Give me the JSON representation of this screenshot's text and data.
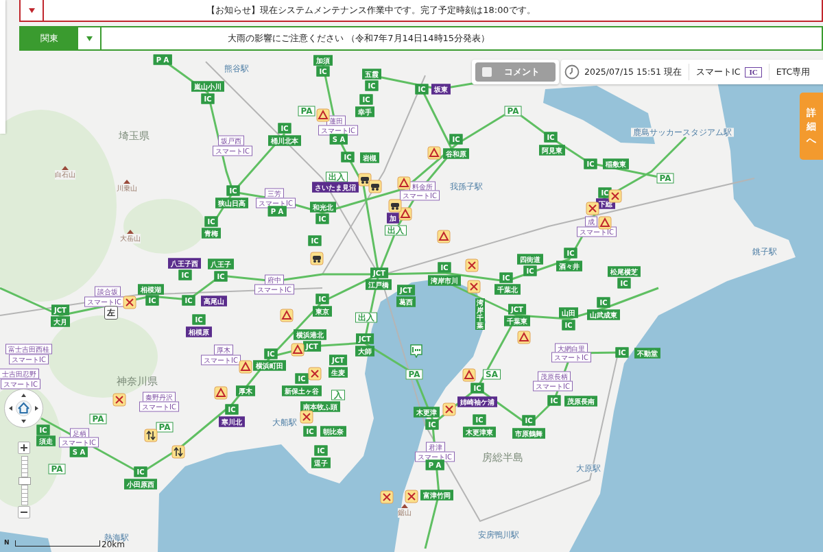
{
  "notices": [
    {
      "kind": "maintenance",
      "text": "【お知らせ】現在システムメンテナンス作業中です。完了予定時刻は18:00です。"
    },
    {
      "kind": "weather",
      "region": "関東",
      "text": "大雨の影響にご注意ください （令和7年7月14日14時15分発表）"
    }
  ],
  "comment_toggle": {
    "label": "コメント",
    "checked": false
  },
  "timestamp": "2025/07/15 15:51 現在",
  "legend": [
    {
      "label": "スマートIC",
      "badge": "IC"
    },
    {
      "label": "ETC専用"
    }
  ],
  "detail_tab": "詳細へ",
  "map": {
    "labels": [
      {
        "text": "P A",
        "kind": "g"
      },
      {
        "text": "加須",
        "kind": "g"
      },
      {
        "text": "IC",
        "kind": "g"
      },
      {
        "text": "五霞",
        "kind": "g"
      },
      {
        "text": "嵐山小川",
        "kind": "g"
      },
      {
        "text": "IC",
        "kind": "g"
      },
      {
        "text": "IC",
        "kind": "g"
      },
      {
        "text": "IC",
        "kind": "g"
      },
      {
        "text": "幸手",
        "kind": "g"
      },
      {
        "text": "IC",
        "kind": "g"
      },
      {
        "text": "坂東",
        "kind": "pf"
      },
      {
        "text": "PA",
        "kind": "go"
      },
      {
        "text": "蓮田",
        "kind": "p"
      },
      {
        "text": "スマートIC",
        "kind": "p"
      },
      {
        "text": "坂戸西",
        "kind": "p"
      },
      {
        "text": "スマートIC",
        "kind": "p"
      },
      {
        "text": "IC",
        "kind": "g"
      },
      {
        "text": "桶川北本",
        "kind": "g"
      },
      {
        "text": "S A",
        "kind": "g"
      },
      {
        "text": "IC",
        "kind": "g"
      },
      {
        "text": "岩槻",
        "kind": "g"
      },
      {
        "text": "PA",
        "kind": "go"
      },
      {
        "text": "IC",
        "kind": "g"
      },
      {
        "text": "谷和原",
        "kind": "g"
      },
      {
        "text": "IC",
        "kind": "g"
      },
      {
        "text": "阿見東",
        "kind": "g"
      },
      {
        "text": "IC",
        "kind": "g"
      },
      {
        "text": "稲敷東",
        "kind": "g"
      },
      {
        "text": "出入",
        "kind": "go"
      },
      {
        "text": "さいたま見沼",
        "kind": "pf"
      },
      {
        "text": "料金所",
        "kind": "p"
      },
      {
        "text": "スマートIC",
        "kind": "p"
      },
      {
        "text": "PA",
        "kind": "go"
      },
      {
        "text": "IC",
        "kind": "g"
      },
      {
        "text": "狭山日高",
        "kind": "g"
      },
      {
        "text": "三芳",
        "kind": "p"
      },
      {
        "text": "スマートIC",
        "kind": "p"
      },
      {
        "text": "P A",
        "kind": "g"
      },
      {
        "text": "和光北",
        "kind": "g"
      },
      {
        "text": "IC",
        "kind": "g"
      },
      {
        "text": "加",
        "kind": "pf"
      },
      {
        "text": "出入",
        "kind": "go"
      },
      {
        "text": "IC",
        "kind": "g"
      },
      {
        "text": "青梅",
        "kind": "g"
      },
      {
        "text": "IC",
        "kind": "g"
      },
      {
        "text": "IC",
        "kind": "g"
      },
      {
        "text": "下総",
        "kind": "pf"
      },
      {
        "text": "成",
        "kind": "p"
      },
      {
        "text": "スマートIC",
        "kind": "p"
      },
      {
        "text": "八王子西",
        "kind": "pf"
      },
      {
        "text": "IC",
        "kind": "g"
      },
      {
        "text": "八王子",
        "kind": "g"
      },
      {
        "text": "IC",
        "kind": "g"
      },
      {
        "text": "府中",
        "kind": "p"
      },
      {
        "text": "スマートIC",
        "kind": "p"
      },
      {
        "text": "JCT",
        "kind": "g"
      },
      {
        "text": "江戸橋",
        "kind": "g"
      },
      {
        "text": "IC",
        "kind": "g"
      },
      {
        "text": "湾岸市川",
        "kind": "g"
      },
      {
        "text": "四街道",
        "kind": "g"
      },
      {
        "text": "IC",
        "kind": "g"
      },
      {
        "text": "IC",
        "kind": "g"
      },
      {
        "text": "千葉北",
        "kind": "g"
      },
      {
        "text": "IC",
        "kind": "g"
      },
      {
        "text": "酒々井",
        "kind": "g"
      },
      {
        "text": "松尾横芝",
        "kind": "g"
      },
      {
        "text": "IC",
        "kind": "g"
      },
      {
        "text": "談合坂",
        "kind": "p"
      },
      {
        "text": "スマートIC",
        "kind": "p"
      },
      {
        "text": "JCT",
        "kind": "g"
      },
      {
        "text": "大月",
        "kind": "g"
      },
      {
        "text": "相模湖",
        "kind": "g"
      },
      {
        "text": "IC",
        "kind": "g"
      },
      {
        "text": "IC",
        "kind": "g"
      },
      {
        "text": "高尾山",
        "kind": "pf"
      },
      {
        "text": "IC",
        "kind": "g"
      },
      {
        "text": "相模原",
        "kind": "pf"
      },
      {
        "text": "IC",
        "kind": "g"
      },
      {
        "text": "東京",
        "kind": "g"
      },
      {
        "text": "JCT",
        "kind": "g"
      },
      {
        "text": "葛西",
        "kind": "g"
      },
      {
        "text": "出入",
        "kind": "go"
      },
      {
        "text": "湾岸千葉",
        "kind": "vg"
      },
      {
        "text": "JCT",
        "kind": "g"
      },
      {
        "text": "千葉東",
        "kind": "g"
      },
      {
        "text": "山田",
        "kind": "g"
      },
      {
        "text": "IC",
        "kind": "g"
      },
      {
        "text": "IC",
        "kind": "g"
      },
      {
        "text": "山武成東",
        "kind": "g"
      },
      {
        "text": "横浜港北",
        "kind": "g"
      },
      {
        "text": "JCT",
        "kind": "g"
      },
      {
        "text": "JCT",
        "kind": "g"
      },
      {
        "text": "大師",
        "kind": "g"
      },
      {
        "text": "JCT",
        "kind": "g"
      },
      {
        "text": "生麦",
        "kind": "g"
      },
      {
        "text": "厚木",
        "kind": "p"
      },
      {
        "text": "スマートIC",
        "kind": "p"
      },
      {
        "text": "IC",
        "kind": "g"
      },
      {
        "text": "横浜町田",
        "kind": "g"
      },
      {
        "text": "富士吉田西桂",
        "kind": "p"
      },
      {
        "text": "スマートIC",
        "kind": "p"
      },
      {
        "text": "士吉田忍野",
        "kind": "p"
      },
      {
        "text": "スマートIC",
        "kind": "p"
      },
      {
        "text": "神奈川県",
        "kind": "place"
      },
      {
        "text": "IC",
        "kind": "g"
      },
      {
        "text": "新保土ヶ谷",
        "kind": "g"
      },
      {
        "text": "入",
        "kind": "go"
      },
      {
        "text": "南本牧ふ頭",
        "kind": "g"
      },
      {
        "text": "厚木",
        "kind": "g"
      },
      {
        "text": "秦野丹沢",
        "kind": "p"
      },
      {
        "text": "スマートIC",
        "kind": "p"
      },
      {
        "text": "IC",
        "kind": "g"
      },
      {
        "text": "寒川北",
        "kind": "pf"
      },
      {
        "text": "IC",
        "kind": "g"
      },
      {
        "text": "朝比奈",
        "kind": "g"
      },
      {
        "text": "IC",
        "kind": "g"
      },
      {
        "text": "逗子",
        "kind": "g"
      },
      {
        "text": "IC",
        "kind": "g"
      },
      {
        "text": "須走",
        "kind": "g"
      },
      {
        "text": "PA",
        "kind": "go"
      },
      {
        "text": "PA",
        "kind": "go"
      },
      {
        "text": "足柄",
        "kind": "p"
      },
      {
        "text": "スマートIC",
        "kind": "p"
      },
      {
        "text": "S A",
        "kind": "g"
      },
      {
        "text": "PA",
        "kind": "go"
      },
      {
        "text": "IC",
        "kind": "g"
      },
      {
        "text": "小田原西",
        "kind": "g"
      },
      {
        "text": "大網白里",
        "kind": "p"
      },
      {
        "text": "スマートIC",
        "kind": "p"
      },
      {
        "text": "IC",
        "kind": "g"
      },
      {
        "text": "不動堂",
        "kind": "g"
      },
      {
        "text": "PA",
        "kind": "go"
      },
      {
        "text": "SA",
        "kind": "go"
      },
      {
        "text": "IC",
        "kind": "g"
      },
      {
        "text": "姉崎袖ケ浦",
        "kind": "pf"
      },
      {
        "text": "木更津",
        "kind": "g"
      },
      {
        "text": "IC",
        "kind": "g"
      },
      {
        "text": "IC",
        "kind": "g"
      },
      {
        "text": "木更津東",
        "kind": "g"
      },
      {
        "text": "IC",
        "kind": "g"
      },
      {
        "text": "市原鶴舞",
        "kind": "g"
      },
      {
        "text": "茂原長柄",
        "kind": "p"
      },
      {
        "text": "スマートIC",
        "kind": "p"
      },
      {
        "text": "IC",
        "kind": "g"
      },
      {
        "text": "茂原長南",
        "kind": "g"
      },
      {
        "text": "君津",
        "kind": "p"
      },
      {
        "text": "スマートIC",
        "kind": "p"
      },
      {
        "text": "P A",
        "kind": "g"
      },
      {
        "text": "富津竹岡",
        "kind": "g"
      },
      {
        "text": "埼玉県",
        "kind": "place"
      },
      {
        "text": "房総半島",
        "kind": "place"
      },
      {
        "text": "白石山",
        "kind": "peak"
      },
      {
        "text": "川乗山",
        "kind": "peak"
      },
      {
        "text": "大岳山",
        "kind": "peak"
      },
      {
        "text": "鋸山",
        "kind": "peak"
      },
      {
        "text": "熊谷駅",
        "kind": "station"
      },
      {
        "text": "鹿島サッカースタジアム駅",
        "kind": "station"
      },
      {
        "text": "銚子駅",
        "kind": "station"
      },
      {
        "text": "大原駅",
        "kind": "station"
      },
      {
        "text": "安房鴨川駅",
        "kind": "station"
      },
      {
        "text": "大船駅",
        "kind": "station"
      },
      {
        "text": "熱海駅",
        "kind": "station"
      },
      {
        "text": "我孫子駅",
        "kind": "station"
      }
    ],
    "incidents": [
      {
        "kind": "warning"
      },
      {
        "kind": "warning"
      },
      {
        "kind": "warning"
      },
      {
        "kind": "warning"
      },
      {
        "kind": "warning"
      },
      {
        "kind": "warning"
      },
      {
        "kind": "warning"
      },
      {
        "kind": "warning"
      },
      {
        "kind": "warning"
      },
      {
        "kind": "warning"
      },
      {
        "kind": "warning"
      },
      {
        "kind": "warning"
      },
      {
        "kind": "closure"
      },
      {
        "kind": "closure"
      },
      {
        "kind": "closure"
      },
      {
        "kind": "closure"
      },
      {
        "kind": "closure"
      },
      {
        "kind": "closure"
      },
      {
        "kind": "closure"
      },
      {
        "kind": "closure"
      },
      {
        "kind": "closure"
      },
      {
        "kind": "closure"
      },
      {
        "kind": "closure"
      },
      {
        "kind": "congestion"
      },
      {
        "kind": "congestion"
      },
      {
        "kind": "congestion"
      },
      {
        "kind": "congestion"
      },
      {
        "kind": "lane"
      },
      {
        "kind": "lane"
      },
      {
        "kind": "sign",
        "text": "左"
      },
      {
        "kind": "parking"
      }
    ]
  },
  "zoom_slider": {
    "level": 0.5
  },
  "scale": "20km",
  "north": "N"
}
